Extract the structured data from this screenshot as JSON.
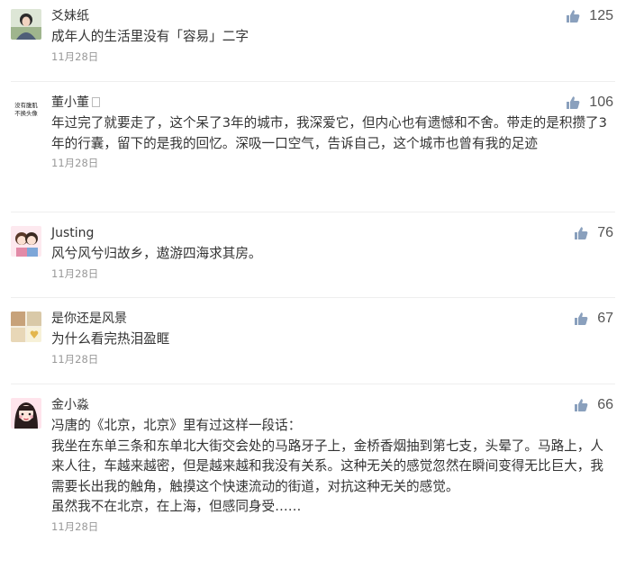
{
  "comments": [
    {
      "username": "爻妹纸",
      "verified": false,
      "avatar_icon": "girl-portrait-avatar-icon",
      "text": "成年人的生活里没有「容易」二字",
      "date": "11月28日",
      "likes": "125"
    },
    {
      "username": "董小董",
      "verified": true,
      "avatar_icon": "text-avatar-icon",
      "avatar_text": [
        "没有腹肌",
        "不换头像"
      ],
      "text": "年过完了就要走了，这个呆了3年的城市，我深爱它，但内心也有遗憾和不舍。带走的是积攒了3年的行囊，留下的是我的回忆。深吸一口空气，告诉自己，这个城市也曾有我的足迹",
      "date": "11月28日",
      "likes": "106"
    },
    {
      "username": "Justing",
      "verified": false,
      "avatar_icon": "cartoon-couple-avatar-icon",
      "text": "风兮风兮归故乡，遨游四海求其房。",
      "date": "11月28日",
      "likes": "76"
    },
    {
      "username": "是你还是风景",
      "verified": false,
      "avatar_icon": "photo-collage-avatar-icon",
      "text": "为什么看完热泪盈眶",
      "date": "11月28日",
      "likes": "67"
    },
    {
      "username": "金小淼",
      "verified": false,
      "avatar_icon": "cartoon-girl-avatar-icon",
      "text": "冯唐的《北京，北京》里有过这样一段话：\n我坐在东单三条和东单北大街交会处的马路牙子上，金桥香烟抽到第七支，头晕了。马路上，人来人往，车越来越密，但是越来越和我没有关系。这种无关的感觉忽然在瞬间变得无比巨大，我需要长出我的触角，触摸这个快速流动的街道，对抗这种无关的感觉。\n虽然我不在北京，在上海，但感同身受……",
      "date": "11月28日",
      "likes": "66"
    }
  ],
  "colors": {
    "username": "#333333",
    "text": "#333333",
    "date": "#999999",
    "like_icon": "#8aa0bd",
    "like_count": "#555555"
  },
  "icons": {
    "like": "thumbs-up-icon"
  }
}
